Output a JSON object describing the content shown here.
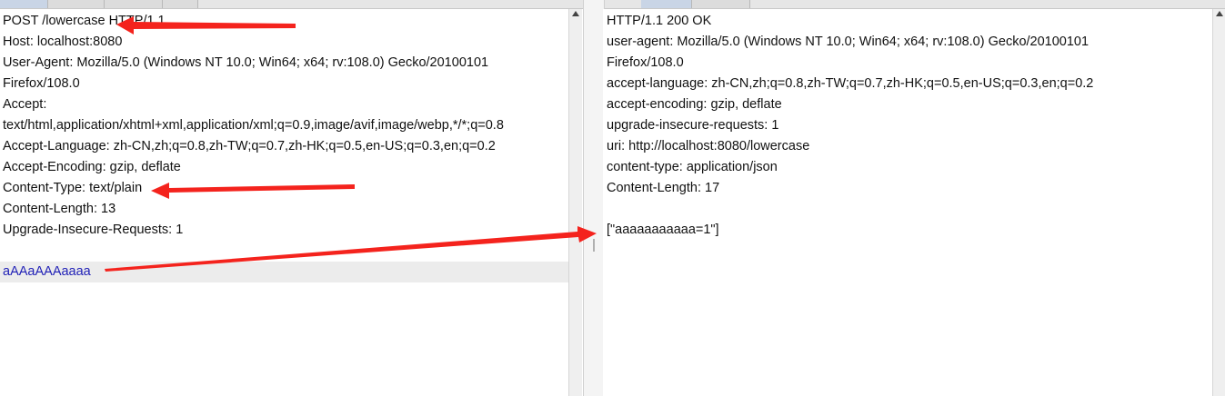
{
  "request": {
    "lines": [
      "POST /lowercase HTTP/1.1",
      "Host: localhost:8080",
      "User-Agent: Mozilla/5.0 (Windows NT 10.0; Win64; x64; rv:108.0) Gecko/20100101",
      "Firefox/108.0",
      "Accept:",
      "text/html,application/xhtml+xml,application/xml;q=0.9,image/avif,image/webp,*/*;q=0.8",
      "Accept-Language: zh-CN,zh;q=0.8,zh-TW;q=0.7,zh-HK;q=0.5,en-US;q=0.3,en;q=0.2",
      "Accept-Encoding: gzip, deflate",
      "Content-Type: text/plain",
      "Content-Length: 13",
      "Upgrade-Insecure-Requests: 1",
      "",
      "aAAaAAAaaaa"
    ]
  },
  "response": {
    "lines": [
      "HTTP/1.1 200 OK",
      "user-agent: Mozilla/5.0 (Windows NT 10.0; Win64; x64; rv:108.0) Gecko/20100101",
      "Firefox/108.0",
      "accept-language: zh-CN,zh;q=0.8,zh-TW;q=0.7,zh-HK;q=0.5,en-US;q=0.3,en;q=0.2",
      "accept-encoding: gzip, deflate",
      "upgrade-insecure-requests: 1",
      "uri: http://localhost:8080/lowercase",
      "content-type: application/json",
      "Content-Length: 17",
      "",
      "[\"aaaaaaaaaaa=1\"]"
    ]
  },
  "colors": {
    "annotation_arrow": "#f4231d",
    "body_text": "#1f1fb6",
    "body_highlight": "#ececec"
  },
  "icons": {
    "scroll_up": "scroll-up-arrow-icon",
    "annotation": "red-arrow-icon"
  }
}
